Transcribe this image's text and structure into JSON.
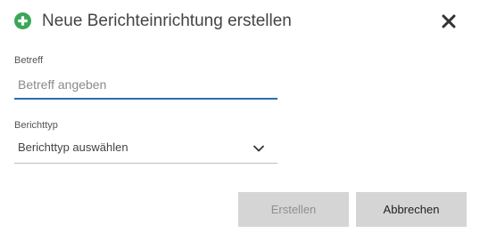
{
  "dialog": {
    "title": "Neue Berichteinrichtung erstellen",
    "title_icon": "plus-circle-icon",
    "close_icon": "close-icon",
    "accent_color": "#2b6cb0",
    "icon_color": "#3aa757"
  },
  "form": {
    "subject": {
      "label": "Betreff",
      "value": "",
      "placeholder": "Betreff angeben"
    },
    "report_type": {
      "label": "Berichttyp",
      "selected": "Berichttyp auswählen",
      "icon": "chevron-down-icon"
    }
  },
  "actions": {
    "create_label": "Erstellen",
    "create_enabled": false,
    "cancel_label": "Abbrechen"
  }
}
